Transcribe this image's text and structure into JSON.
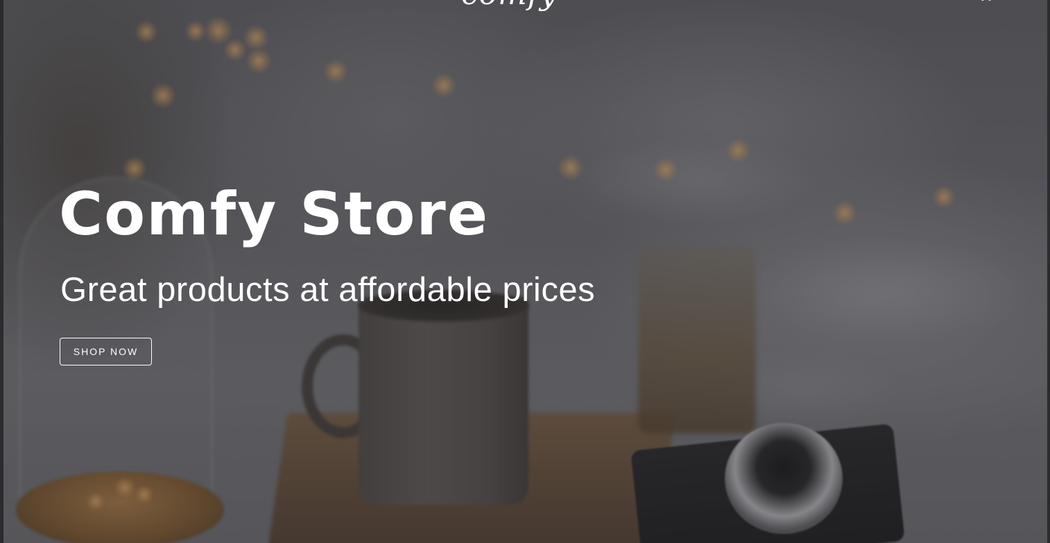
{
  "nav": {
    "logo_text": "comfy",
    "cart_icon": "cart-icon"
  },
  "hero": {
    "title": "Comfy Store",
    "subtitle": "Great products at affordable prices",
    "cta_label": "SHOP NOW",
    "background_image": "blurred-cozy-coffee-mug-camera-photo"
  },
  "colors": {
    "text": "#ffffff",
    "overlay": "#222226",
    "frame": "#2b2b2d"
  }
}
